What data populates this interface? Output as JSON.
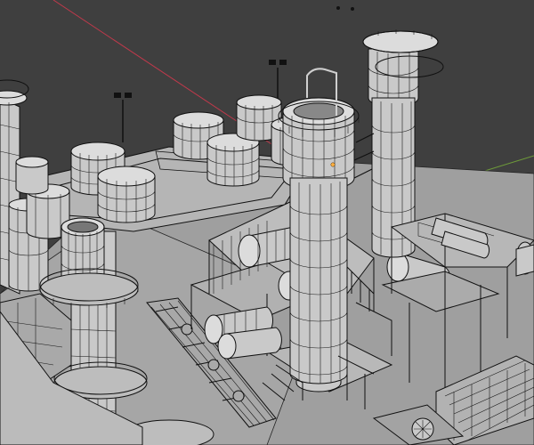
{
  "viewport": {
    "colors": {
      "background": "#3f3f3f",
      "ground": "#9f9f9f",
      "x_axis": "#c0394b",
      "y_axis": "#6e9a3a",
      "object_fill": "#c9c9c9",
      "wire": "#101010",
      "origin_point": "#ffb040"
    }
  }
}
